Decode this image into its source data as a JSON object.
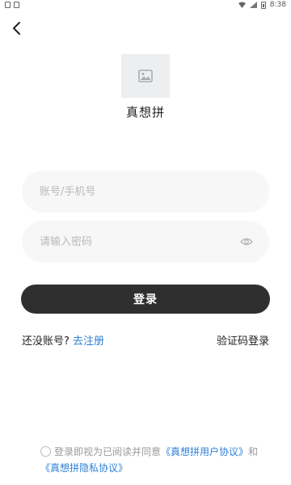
{
  "status_bar": {
    "time": "8:38"
  },
  "app": {
    "name": "真想拼"
  },
  "form": {
    "account_placeholder": "账号/手机号",
    "password_placeholder": "请输入密码",
    "login_label": "登录"
  },
  "links": {
    "no_account": "还没账号?",
    "register": "去注册",
    "sms_login": "验证码登录"
  },
  "agreement": {
    "prefix": "登录即视为已阅读并同意",
    "user_agreement": "《真想拼用户协议》",
    "and": "和",
    "privacy_policy": "《真想拼隐私协议》"
  },
  "colors": {
    "link": "#2f7fd6",
    "button": "#2f2f2f",
    "field_bg": "#f7f7f8"
  },
  "icons": [
    "back-arrow-icon",
    "image-placeholder-icon",
    "eye-icon",
    "wifi-icon",
    "battery-icon"
  ]
}
